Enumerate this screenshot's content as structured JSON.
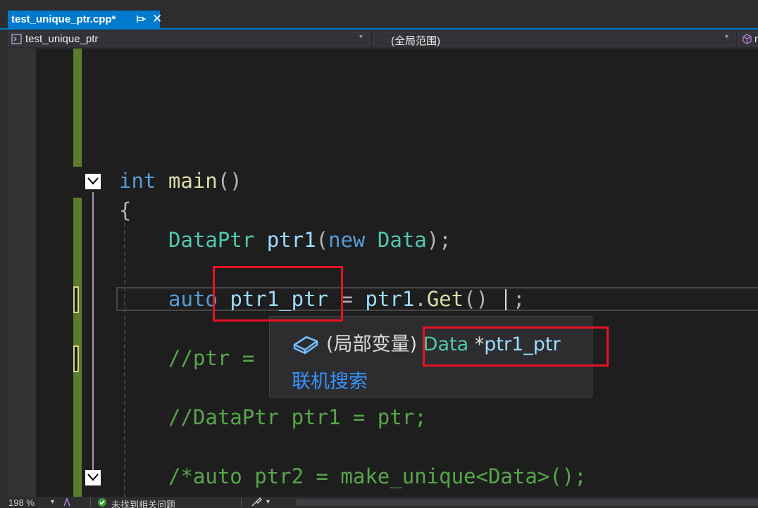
{
  "tab": {
    "title": "test_unique_ptr.cpp*",
    "close_glyph": "✕"
  },
  "nav": {
    "project": "test_unique_ptr",
    "scope": "(全局范围)",
    "member_abbrev": "m",
    "arrow": "▾"
  },
  "code": {
    "line_main": {
      "kw": "int",
      "fn": "main",
      "rest": "()"
    },
    "line_brace": "{",
    "line_ptr1": {
      "ty1": "DataPtr",
      "var": "ptr1",
      "p1": "(",
      "kw": "new",
      "ty2": "Data",
      "p2": ");"
    },
    "line_auto": {
      "kw": "auto",
      "var": "ptr1_ptr",
      "op": "=",
      "obj": "ptr1",
      "dot": ".",
      "fn": "Get",
      "call": "()",
      "semi": ";"
    },
    "line_comment1": "//ptr = ",
    "line_comment2": "//DataPtr ptr1 = ptr;",
    "line_comment3": "/*auto ptr2 = make_unique<Data>();"
  },
  "tooltip": {
    "kind": "(局部变量)",
    "type": "Data",
    "star": "*",
    "name": "ptr1_ptr",
    "link": "联机搜索",
    "icon": "local-variable-icon"
  },
  "status": {
    "zoom": "198 %",
    "issues": "未找到相关问题"
  },
  "colors": {
    "accent": "#007acc",
    "keyword": "#569cd6",
    "type": "#4ec9b0",
    "variable": "#9cdcfe",
    "function": "#dcdcaa",
    "comment": "#57a64a",
    "annotation": "#e81123"
  }
}
